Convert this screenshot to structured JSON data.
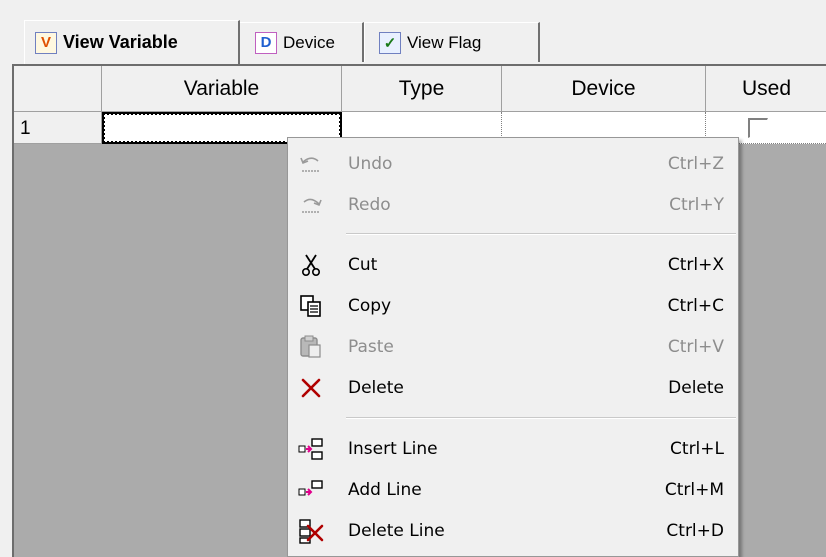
{
  "tabs": [
    {
      "icon_letter": "V",
      "label": "View Variable",
      "icon": "variable-icon",
      "icon_color": "#e05000"
    },
    {
      "icon_letter": "D",
      "label": "Device",
      "icon": "device-icon",
      "icon_color": "#2060d0"
    },
    {
      "icon_letter": "✓",
      "label": "View Flag",
      "icon": "flag-icon",
      "icon_color": "#1a7a1a"
    }
  ],
  "grid": {
    "columns": [
      "Variable",
      "Type",
      "Device",
      "Used"
    ],
    "rows": [
      {
        "num": "1",
        "variable": "",
        "type": "",
        "device": "",
        "used": false
      }
    ]
  },
  "menu": {
    "items": [
      {
        "label": "Undo",
        "shortcut": "Ctrl+Z",
        "icon": "undo-icon",
        "enabled": false
      },
      {
        "label": "Redo",
        "shortcut": "Ctrl+Y",
        "icon": "redo-icon",
        "enabled": false
      },
      {
        "label": "Cut",
        "shortcut": "Ctrl+X",
        "icon": "scissors-icon",
        "enabled": true
      },
      {
        "label": "Copy",
        "shortcut": "Ctrl+C",
        "icon": "copy-icon",
        "enabled": true
      },
      {
        "label": "Paste",
        "shortcut": "Ctrl+V",
        "icon": "paste-icon",
        "enabled": false
      },
      {
        "label": "Delete",
        "shortcut": "Delete",
        "icon": "delete-x-icon",
        "enabled": true
      },
      {
        "label": "Insert Line",
        "shortcut": "Ctrl+L",
        "icon": "insert-line-icon",
        "enabled": true
      },
      {
        "label": "Add Line",
        "shortcut": "Ctrl+M",
        "icon": "add-line-icon",
        "enabled": true
      },
      {
        "label": "Delete Line",
        "shortcut": "Ctrl+D",
        "icon": "delete-line-icon",
        "enabled": true
      }
    ]
  },
  "colors": {
    "delete_red": "#c00000",
    "insert_magenta": "#e0008c"
  }
}
